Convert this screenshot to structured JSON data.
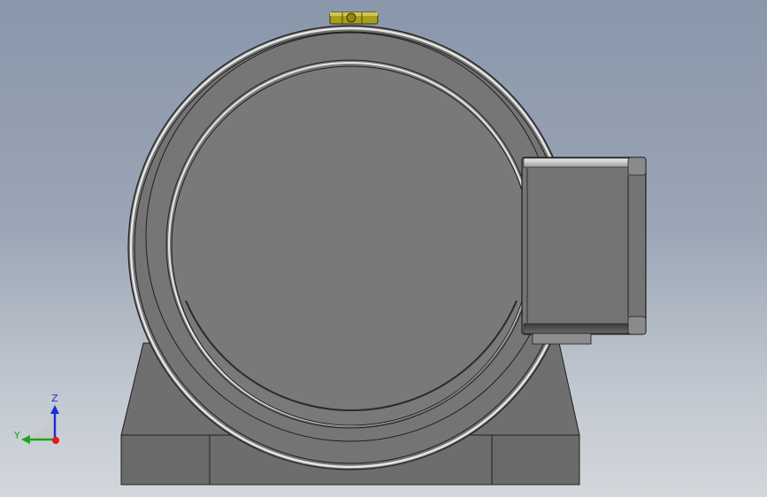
{
  "viewport": {
    "background_top": "#8a97ab",
    "background_bottom": "#d3d7dc"
  },
  "model": {
    "body_color": "#7a7a7a",
    "edge_color": "#1f1f1f",
    "highlight_color": "#e6e6e6",
    "base_color": "#6f6f6f",
    "fitting_color": "#a8a01c"
  },
  "triad": {
    "z_label": "Z",
    "y_label": "Y",
    "z_color": "#1a2ee0",
    "y_color": "#1aa51a",
    "x_color": "#e01a1a"
  }
}
